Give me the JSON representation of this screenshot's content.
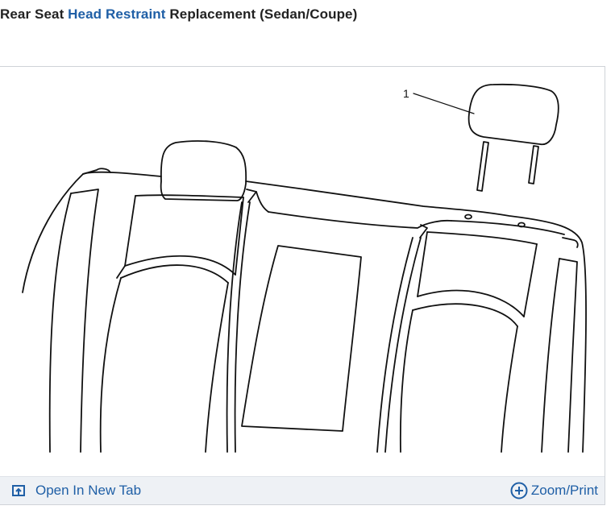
{
  "page": {
    "title_prefix": "Rear Seat ",
    "title_link": "Head Restraint",
    "title_suffix": " Replacement (Sedan/Coupe)"
  },
  "figure": {
    "callouts": [
      {
        "label": "1"
      }
    ],
    "toolbar": {
      "open_new_tab_label": "Open In New Tab",
      "zoom_print_label": "Zoom/Print"
    }
  },
  "colors": {
    "link": "#1f5fa6",
    "toolbar_bg": "#eef1f5",
    "frame_border": "#cfd3d8"
  },
  "icons": {
    "open_new_tab": "open-new-tab-icon",
    "zoom": "zoom-plus-icon"
  }
}
